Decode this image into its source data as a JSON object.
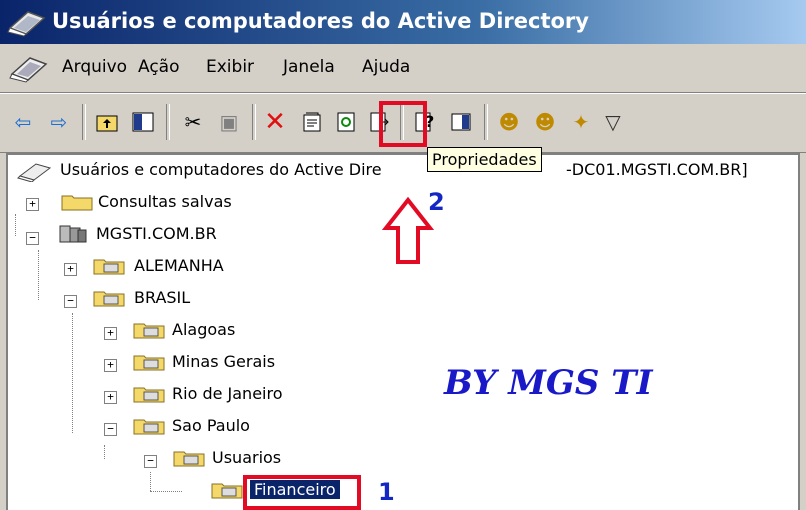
{
  "window": {
    "title": "Usuários e computadores do Active Directory"
  },
  "menu": {
    "items": [
      "Arquivo",
      "Ação",
      "Exibir",
      "Janela",
      "Ajuda"
    ]
  },
  "toolbar": {
    "tooltip": "Propriedades"
  },
  "tree": {
    "root_label": "Usuários e computadores do Active Directory [MGSTI-DC01.MGSTI.COM.BR]",
    "root_label_visible": "Usuários e computadores do Active Dire",
    "root_label_tail": "-DC01.MGSTI.COM.BR]",
    "saved_queries": "Consultas salvas",
    "domain": "MGSTI.COM.BR",
    "ou_alemanha": "ALEMANHA",
    "ou_brasil": "BRASIL",
    "ou_alagoas": "Alagoas",
    "ou_minas": "Minas Gerais",
    "ou_rio": "Rio de Janeiro",
    "ou_saopaulo": "Sao Paulo",
    "ou_usuarios": "Usuarios",
    "ou_financeiro": "Financeiro"
  },
  "annotations": {
    "step1": "1",
    "step2": "2",
    "watermark": "BY MGS TI",
    "accent_color": "#e30b23",
    "number_color": "#1427c4"
  }
}
